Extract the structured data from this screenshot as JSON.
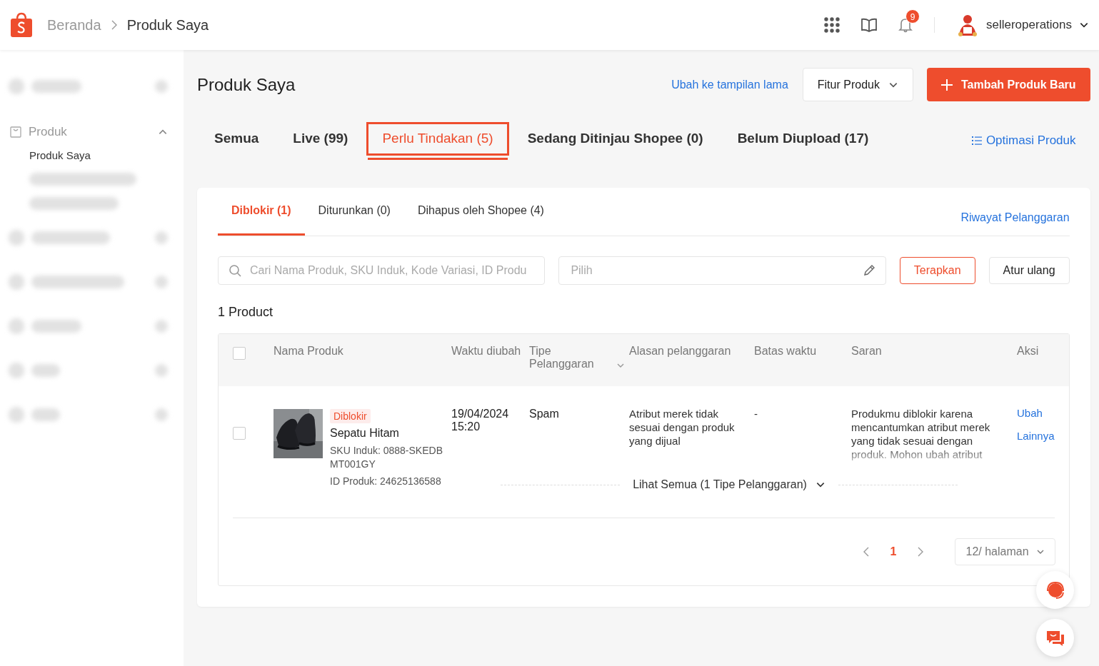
{
  "header": {
    "breadcrumb": [
      {
        "label": "Beranda",
        "selected": false
      },
      {
        "label": "Produk Saya",
        "selected": true
      }
    ],
    "notification_count": "9",
    "username": "selleroperations"
  },
  "sidebar": {
    "items": [
      {
        "kind": "redacted"
      },
      {
        "kind": "group",
        "label": "Produk",
        "expanded": true,
        "children": [
          {
            "kind": "link",
            "label": "Produk Saya",
            "selected": true
          },
          {
            "kind": "redacted"
          },
          {
            "kind": "redacted"
          }
        ]
      },
      {
        "kind": "redacted"
      },
      {
        "kind": "redacted"
      },
      {
        "kind": "redacted"
      },
      {
        "kind": "redacted"
      },
      {
        "kind": "redacted"
      }
    ]
  },
  "page": {
    "title": "Produk Saya",
    "old_view_link": "Ubah ke tampilan lama",
    "feature_button": "Fitur Produk",
    "add_button": "Tambah Produk Baru"
  },
  "tabs": [
    {
      "label": "Semua",
      "selected": false
    },
    {
      "label": "Live (99)",
      "selected": false
    },
    {
      "label": "Perlu Tindakan (5)",
      "selected": true
    },
    {
      "label": "Sedang Ditinjau Shopee (0)",
      "selected": false
    },
    {
      "label": "Belum Diupload (17)",
      "selected": false
    }
  ],
  "optimize_link": "Optimasi Produk",
  "subtabs": [
    {
      "label": "Diblokir (1)",
      "selected": true
    },
    {
      "label": "Diturunkan (0)",
      "selected": false
    },
    {
      "label": "Dihapus oleh Shopee (4)",
      "selected": false
    }
  ],
  "history_link": "Riwayat Pelanggaran",
  "search": {
    "placeholder": "Cari Nama Produk, SKU Induk, Kode Variasi, ID Produ"
  },
  "filter": {
    "placeholder": "Pilih"
  },
  "apply_button": "Terapkan",
  "reset_button": "Atur ulang",
  "count": "1 Product",
  "table": {
    "select_all": {
      "checked": false
    },
    "columns": [
      "Nama Produk",
      "Waktu diubah",
      "Tipe Pelanggaran",
      "Alasan pelanggaran",
      "Batas waktu",
      "Saran",
      "Aksi"
    ],
    "rows": [
      {
        "checked": false,
        "status": "Diblokir",
        "name": "Sepatu Hitam",
        "sku": "SKU Induk: 0888-SKEDB MT001GY",
        "product_id": "ID Produk: 24625136588",
        "time": "19/04/2024 15:20",
        "type": "Spam",
        "reason": "Atribut merek tidak sesuai dengan produk yang dijual",
        "deadline": "-",
        "suggestion": "Produkmu diblokir karena mencantumkan atribut merek yang tidak sesuai dengan produk. Mohon ubah atribut",
        "actions": [
          "Ubah",
          "Lainnya"
        ],
        "more": "Lihat Semua (1 Tipe Pelanggaran)"
      }
    ]
  },
  "pagination": {
    "pages": [
      {
        "label": "1",
        "selected": true
      }
    ],
    "page_size": "12/ halaman"
  }
}
